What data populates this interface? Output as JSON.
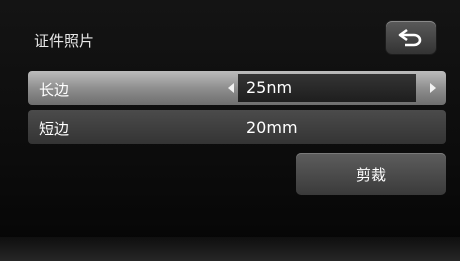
{
  "header": {
    "title": "证件照片",
    "back_icon": "return-arrow-icon"
  },
  "settings": {
    "long_side": {
      "label": "长边",
      "value": "25nm",
      "selected": true
    },
    "short_side": {
      "label": "短边",
      "value": "20mm",
      "selected": false
    }
  },
  "actions": {
    "crop_label": "剪裁"
  },
  "colors": {
    "selected_row": "#a5a5a5",
    "row": "#404040",
    "button": "#4a4a4a",
    "background": "#0f0f0f"
  }
}
